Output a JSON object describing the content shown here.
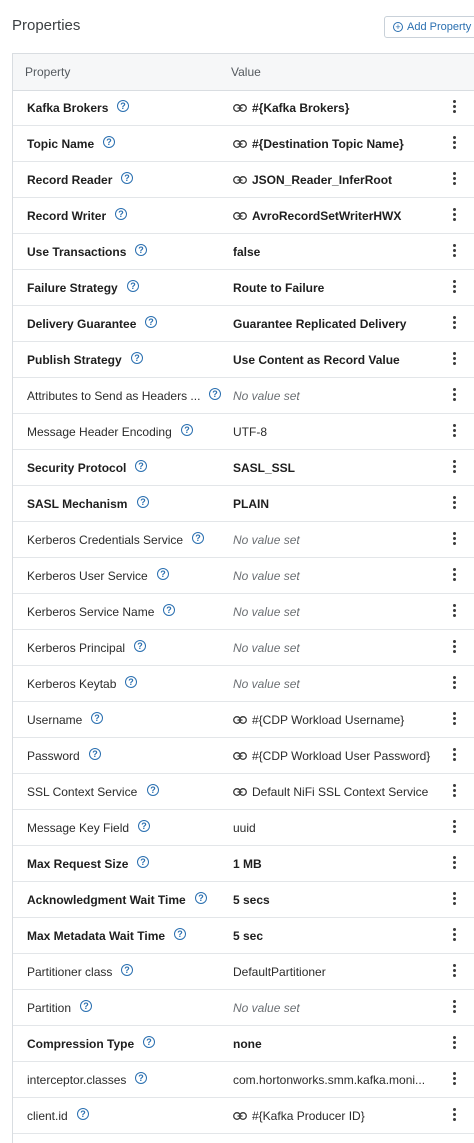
{
  "header": {
    "title": "Properties",
    "add_button_label": "Add Property"
  },
  "table": {
    "col_property": "Property",
    "col_value": "Value",
    "rows": [
      {
        "name": "Kafka Brokers",
        "bold": true,
        "value": "#{Kafka Brokers}",
        "linked": true,
        "value_style": "bold"
      },
      {
        "name": "Topic Name",
        "bold": true,
        "value": "#{Destination Topic Name}",
        "linked": true,
        "value_style": "bold"
      },
      {
        "name": "Record Reader",
        "bold": true,
        "value": "JSON_Reader_InferRoot",
        "linked": true,
        "value_style": "bold"
      },
      {
        "name": "Record Writer",
        "bold": true,
        "value": "AvroRecordSetWriterHWX",
        "linked": true,
        "value_style": "bold"
      },
      {
        "name": "Use Transactions",
        "bold": true,
        "value": "false",
        "linked": false,
        "value_style": "bold"
      },
      {
        "name": "Failure Strategy",
        "bold": true,
        "value": "Route to Failure",
        "linked": false,
        "value_style": "bold"
      },
      {
        "name": "Delivery Guarantee",
        "bold": true,
        "value": "Guarantee Replicated Delivery",
        "linked": false,
        "value_style": "bold"
      },
      {
        "name": "Publish Strategy",
        "bold": true,
        "value": "Use Content as Record Value",
        "linked": false,
        "value_style": "bold"
      },
      {
        "name": "Attributes to Send as Headers ...",
        "bold": false,
        "value": "No value set",
        "linked": false,
        "value_style": "empty"
      },
      {
        "name": "Message Header Encoding",
        "bold": false,
        "value": "UTF-8",
        "linked": false,
        "value_style": "normal"
      },
      {
        "name": "Security Protocol",
        "bold": true,
        "value": "SASL_SSL",
        "linked": false,
        "value_style": "bold"
      },
      {
        "name": "SASL Mechanism",
        "bold": true,
        "value": "PLAIN",
        "linked": false,
        "value_style": "bold"
      },
      {
        "name": "Kerberos Credentials Service",
        "bold": false,
        "value": "No value set",
        "linked": false,
        "value_style": "empty"
      },
      {
        "name": "Kerberos User Service",
        "bold": false,
        "value": "No value set",
        "linked": false,
        "value_style": "empty"
      },
      {
        "name": "Kerberos Service Name",
        "bold": false,
        "value": "No value set",
        "linked": false,
        "value_style": "empty"
      },
      {
        "name": "Kerberos Principal",
        "bold": false,
        "value": "No value set",
        "linked": false,
        "value_style": "empty"
      },
      {
        "name": "Kerberos Keytab",
        "bold": false,
        "value": "No value set",
        "linked": false,
        "value_style": "empty"
      },
      {
        "name": "Username",
        "bold": false,
        "value": "#{CDP Workload Username}",
        "linked": true,
        "value_style": "normal"
      },
      {
        "name": "Password",
        "bold": false,
        "value": "#{CDP Workload User Password}",
        "linked": true,
        "value_style": "normal"
      },
      {
        "name": "SSL Context Service",
        "bold": false,
        "value": "Default NiFi SSL Context Service",
        "linked": true,
        "value_style": "normal"
      },
      {
        "name": "Message Key Field",
        "bold": false,
        "value": "uuid",
        "linked": false,
        "value_style": "normal"
      },
      {
        "name": "Max Request Size",
        "bold": true,
        "value": "1 MB",
        "linked": false,
        "value_style": "bold"
      },
      {
        "name": "Acknowledgment Wait Time",
        "bold": true,
        "value": "5 secs",
        "linked": false,
        "value_style": "bold"
      },
      {
        "name": "Max Metadata Wait Time",
        "bold": true,
        "value": "5 sec",
        "linked": false,
        "value_style": "bold"
      },
      {
        "name": "Partitioner class",
        "bold": false,
        "value": "DefaultPartitioner",
        "linked": false,
        "value_style": "normal"
      },
      {
        "name": "Partition",
        "bold": false,
        "value": "No value set",
        "linked": false,
        "value_style": "empty"
      },
      {
        "name": "Compression Type",
        "bold": true,
        "value": "none",
        "linked": false,
        "value_style": "bold"
      },
      {
        "name": "interceptor.classes",
        "bold": false,
        "value": "com.hortonworks.smm.kafka.moni...",
        "linked": false,
        "value_style": "normal"
      },
      {
        "name": "client.id",
        "bold": false,
        "value": "#{Kafka Producer ID}",
        "linked": true,
        "value_style": "normal"
      }
    ]
  },
  "icons": {
    "help": "help-circle-icon",
    "link": "parameter-link-icon",
    "menu": "kebab-menu-icon",
    "add": "plus-circle-icon"
  },
  "colors": {
    "accent": "#2a6fb0",
    "header_bg": "#f6f7f8",
    "border": "#d9dde1"
  }
}
